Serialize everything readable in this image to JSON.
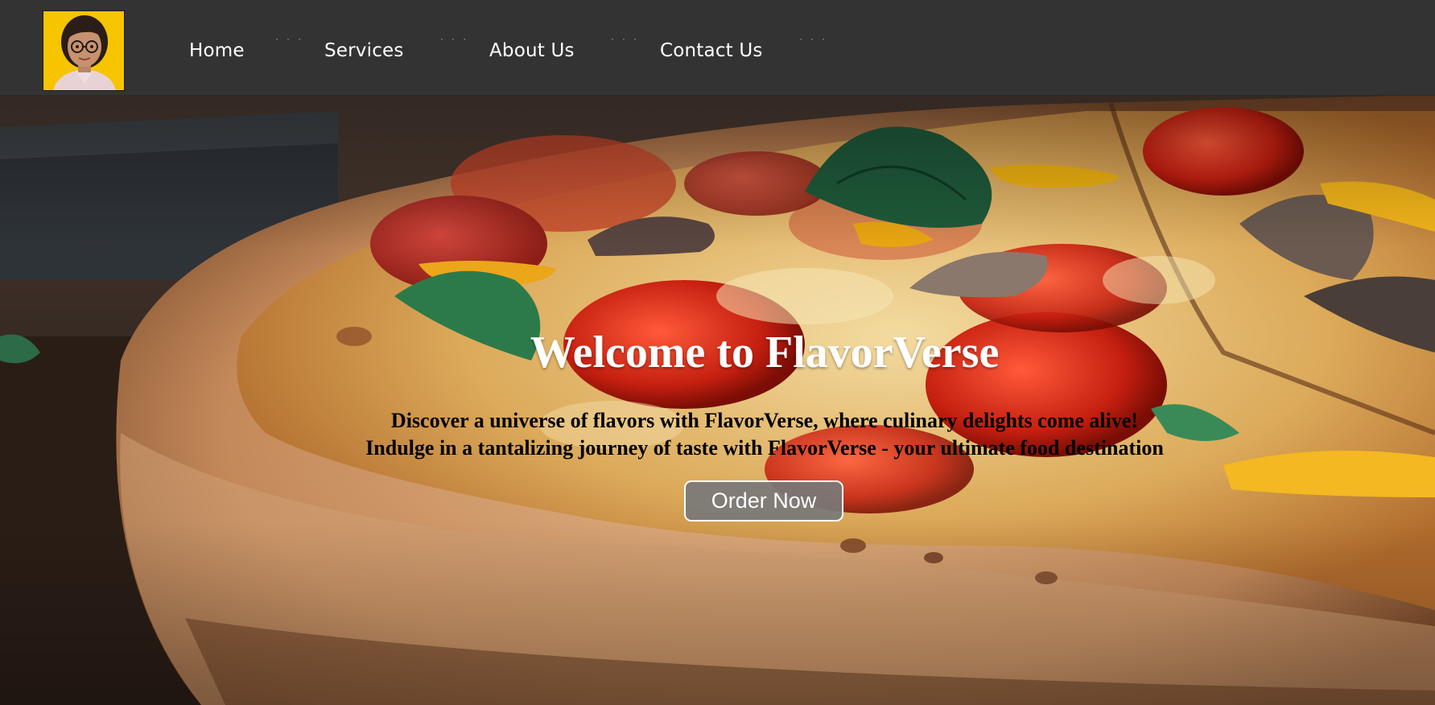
{
  "nav": {
    "avatar_icon": "profile-photo",
    "links": [
      {
        "label": "Home"
      },
      {
        "label": "Services"
      },
      {
        "label": "About Us"
      },
      {
        "label": "Contact Us"
      }
    ],
    "separator": "· · ·"
  },
  "hero": {
    "title": "Welcome to FlavorVerse",
    "line1": "Discover a universe of flavors with FlavorVerse, where culinary delights come alive!",
    "line2": "Indulge in a tantalizing journey of taste with FlavorVerse - your ultimate food destination",
    "cta_label": "Order Now"
  },
  "colors": {
    "navbar_bg": "#333333",
    "avatar_bg": "#f5c400",
    "title_color": "#ffffff",
    "tagline_color": "#000000",
    "button_bg": "#787878"
  }
}
